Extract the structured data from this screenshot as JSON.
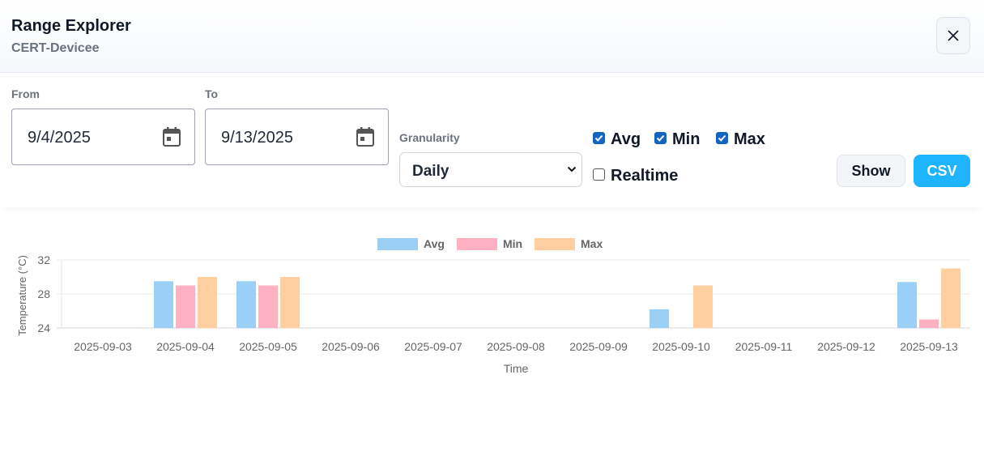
{
  "header": {
    "title": "Range Explorer",
    "subtitle": "CERT-Devicee",
    "close_icon": "close-icon"
  },
  "controls": {
    "from_label": "From",
    "from_value": "9/4/2025",
    "to_label": "To",
    "to_value": "9/13/2025",
    "granularity_label": "Granularity",
    "granularity_value": "Daily",
    "checkboxes": {
      "avg": {
        "label": "Avg",
        "checked": true
      },
      "min": {
        "label": "Min",
        "checked": true
      },
      "max": {
        "label": "Max",
        "checked": true
      },
      "realtime": {
        "label": "Realtime",
        "checked": false
      }
    },
    "show_label": "Show",
    "csv_label": "CSV",
    "accent_color": "#1eb4ff",
    "checkbox_color": "#1565c0"
  },
  "chart_data": {
    "type": "bar",
    "categories": [
      "2025-09-03",
      "2025-09-04",
      "2025-09-05",
      "2025-09-06",
      "2025-09-07",
      "2025-09-08",
      "2025-09-09",
      "2025-09-10",
      "2025-09-11",
      "2025-09-12",
      "2025-09-13"
    ],
    "series": [
      {
        "name": "Avg",
        "color": "#9ad0f5",
        "values": [
          null,
          29.5,
          29.5,
          null,
          null,
          null,
          null,
          26.2,
          null,
          null,
          29.4
        ]
      },
      {
        "name": "Min",
        "color": "#ffb1c1",
        "values": [
          null,
          29.0,
          29.0,
          null,
          null,
          null,
          null,
          null,
          null,
          null,
          25.0
        ]
      },
      {
        "name": "Max",
        "color": "#ffcf9f",
        "values": [
          null,
          30.0,
          30.0,
          null,
          null,
          null,
          null,
          29.0,
          null,
          null,
          31.0
        ]
      }
    ],
    "xlabel": "Time",
    "ylabel": "Temperature (°C)",
    "ylim": [
      24,
      32
    ],
    "yticks": [
      24,
      28,
      32
    ],
    "grid": true,
    "legend": "top-center"
  }
}
